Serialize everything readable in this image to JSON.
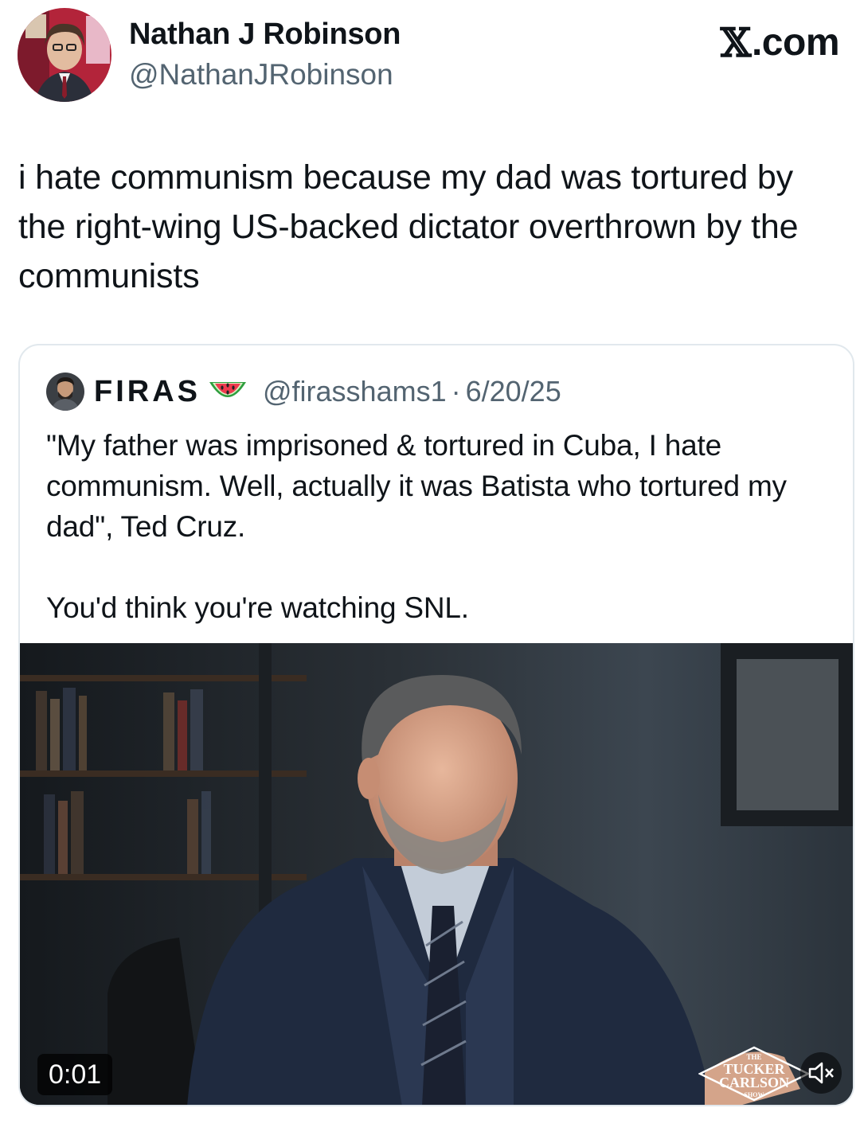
{
  "author": {
    "name": "Nathan J Robinson",
    "handle": "@NathanJRobinson",
    "avatar_icon": "profile-photo"
  },
  "brand": {
    "x_glyph": "𝕏",
    "domain": ".com"
  },
  "tweet": {
    "text": "i hate communism because my dad was tortured by the right-wing US-backed dictator overthrown by the communists"
  },
  "quote": {
    "name": "FIRAS",
    "emoji_icon": "watermelon-icon",
    "handle": "@firasshams1",
    "separator": "·",
    "date": "6/20/25",
    "paragraph1": "\"My father was imprisoned & tortured in Cuba, I hate communism. Well, actually it was Batista who tortured my dad\", Ted Cruz.",
    "paragraph2": "You'd think you're watching SNL.",
    "video": {
      "timestamp": "0:01",
      "watermark_line1": "THE",
      "watermark_line2": "TUCKER",
      "watermark_line3": "CARLSON",
      "watermark_line4": "SHOW",
      "mute_icon": "speaker-muted-icon"
    }
  },
  "colors": {
    "text": "#0f1419",
    "secondary_text": "#536471",
    "card_border": "#e1e8ed"
  }
}
